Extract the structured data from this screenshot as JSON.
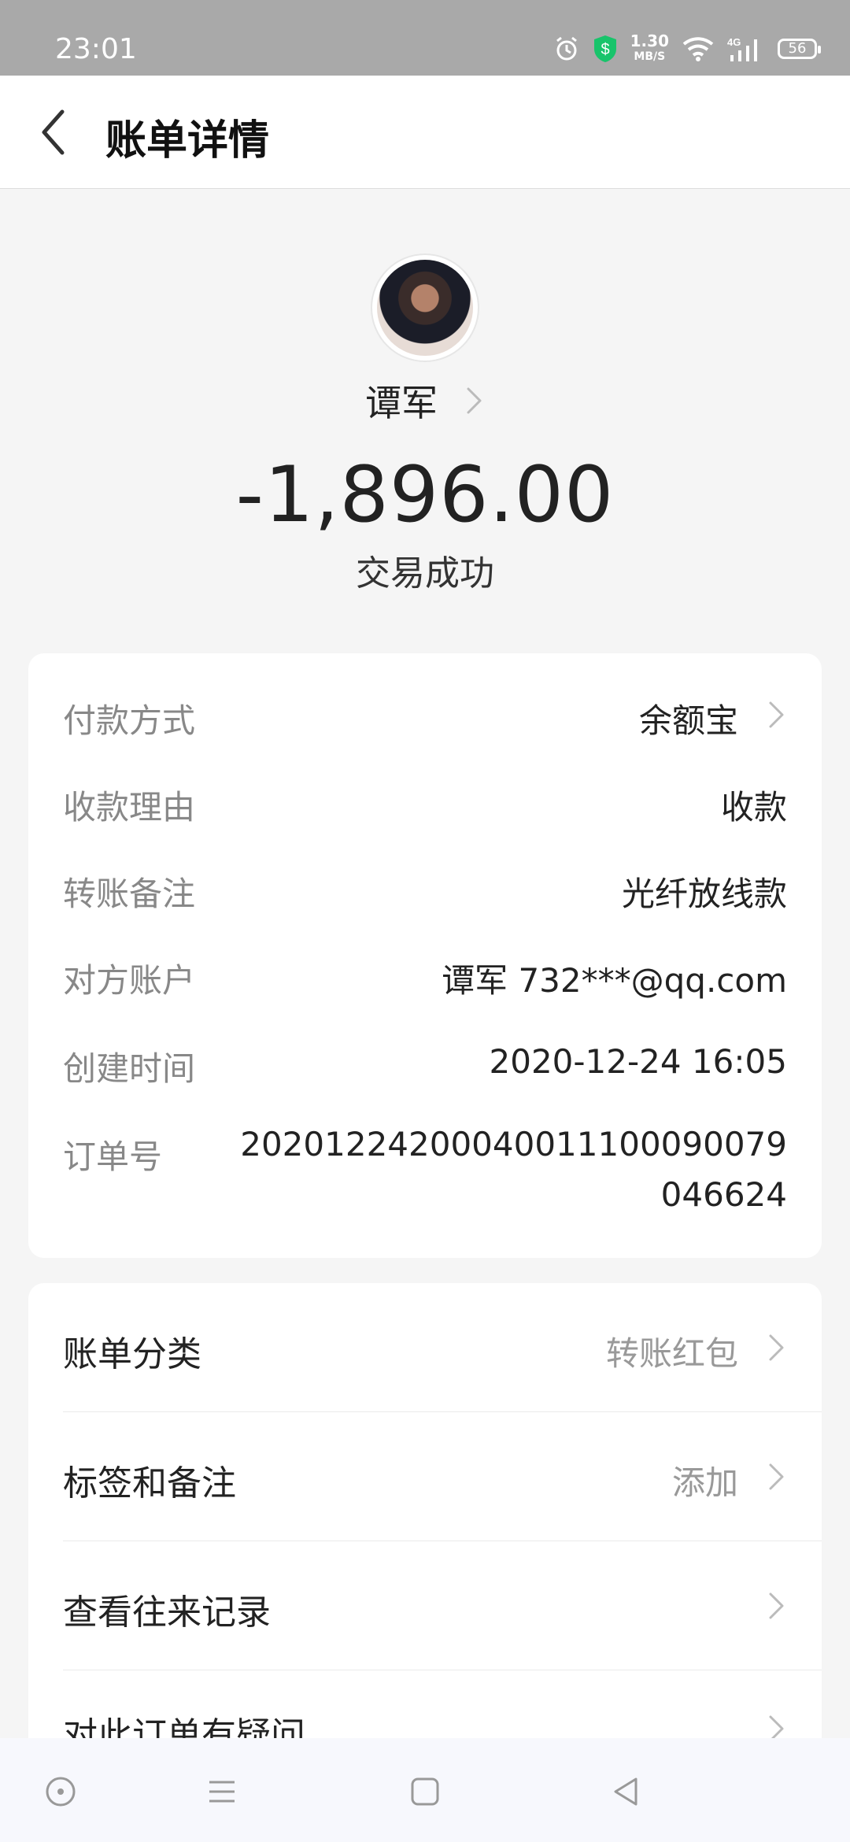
{
  "status_bar": {
    "time": "23:01",
    "network_speed": "1.30",
    "network_unit": "MB/S",
    "network_type": "4G",
    "battery": "56"
  },
  "nav": {
    "title": "账单详情"
  },
  "transaction": {
    "payee": "谭军",
    "amount": "-1,896.00",
    "status": "交易成功"
  },
  "details": [
    {
      "label": "付款方式",
      "value": "余额宝"
    },
    {
      "label": "收款理由",
      "value": "收款"
    },
    {
      "label": "转账备注",
      "value": "光纤放线款"
    },
    {
      "label": "对方账户",
      "value": "谭军 732***@qq.com"
    },
    {
      "label": "创建时间",
      "value": "2020-12-24 16:05"
    },
    {
      "label": "订单号",
      "value": "20201224200040011100090079046624"
    }
  ],
  "actions": [
    {
      "label": "账单分类",
      "value": "转账红包"
    },
    {
      "label": "标签和备注",
      "value": "添加"
    },
    {
      "label": "查看往来记录",
      "value": ""
    },
    {
      "label": "对此订单有疑问",
      "value": ""
    }
  ],
  "colors": {
    "status_bar": "#a9a9a9",
    "background": "#f5f5f5",
    "card": "#ffffff",
    "secondary_text": "#888888",
    "shield_green": "#18c46b"
  },
  "icons": [
    "alarm-icon",
    "shield-icon",
    "wifi-icon",
    "signal-icon",
    "battery-icon",
    "back-arrow-icon",
    "chevron-right-icon",
    "circle-dot-icon",
    "menu-icon",
    "square-icon",
    "triangle-back-icon"
  ]
}
